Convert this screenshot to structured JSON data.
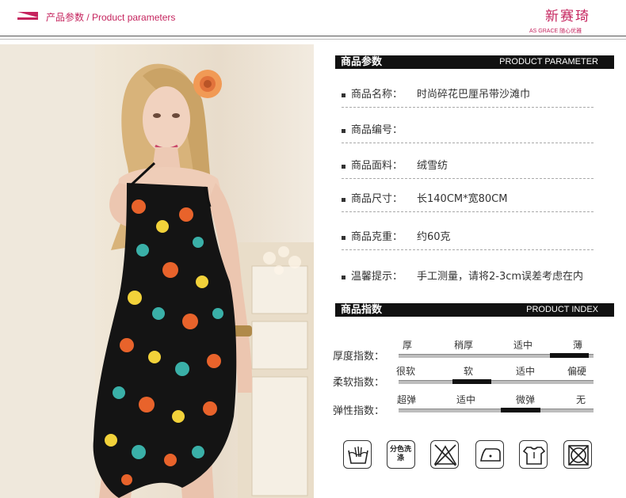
{
  "header": {
    "title": "产品参数 / Product parameters",
    "brand_cn": "新赛琦",
    "brand_en": "AS GRACE 随心优雅"
  },
  "param_section": {
    "title_cn": "商品参数",
    "title_en": "PRODUCT PARAMETER",
    "rows": [
      {
        "label": "商品名称：",
        "value": "时尚碎花巴厘吊带沙滩巾"
      },
      {
        "label": "商品编号：",
        "value": ""
      },
      {
        "label": "商品面料：",
        "value": "绒雪纺"
      },
      {
        "label": "商品尺寸：",
        "value": "长140CM*宽80CM"
      },
      {
        "label": "商品克重：",
        "value": "约60克"
      },
      {
        "label": "温馨提示：",
        "value": "手工测量，请将2-3cm误差考虑在内"
      }
    ]
  },
  "index_section": {
    "title_cn": "商品指数",
    "title_en": "PRODUCT INDEX",
    "rows": [
      {
        "label": "厚度指数：",
        "levels": [
          "厚",
          "稍厚",
          "适中",
          "薄"
        ],
        "selected": 3
      },
      {
        "label": "柔软指数：",
        "levels": [
          "很软",
          "软",
          "适中",
          "偏硬"
        ],
        "selected": 1
      },
      {
        "label": "弹性指数：",
        "levels": [
          "超弹",
          "适中",
          "微弹",
          "无"
        ],
        "selected": 2
      }
    ]
  },
  "care_icons": [
    {
      "name": "hand-wash-icon",
      "text": ""
    },
    {
      "name": "wash-separately-icon",
      "text": "分色洗涤"
    },
    {
      "name": "no-bleach-icon",
      "text": ""
    },
    {
      "name": "iron-low-icon",
      "text": ""
    },
    {
      "name": "hang-dry-icon",
      "text": ""
    },
    {
      "name": "no-tumble-dry-icon",
      "text": ""
    }
  ],
  "colors": {
    "accent": "#c5245e",
    "bar": "#111111",
    "dress_base": "#141414",
    "flower_orange": "#e8632b",
    "flower_yellow": "#f2d23a",
    "flower_teal": "#3ab0a8"
  }
}
